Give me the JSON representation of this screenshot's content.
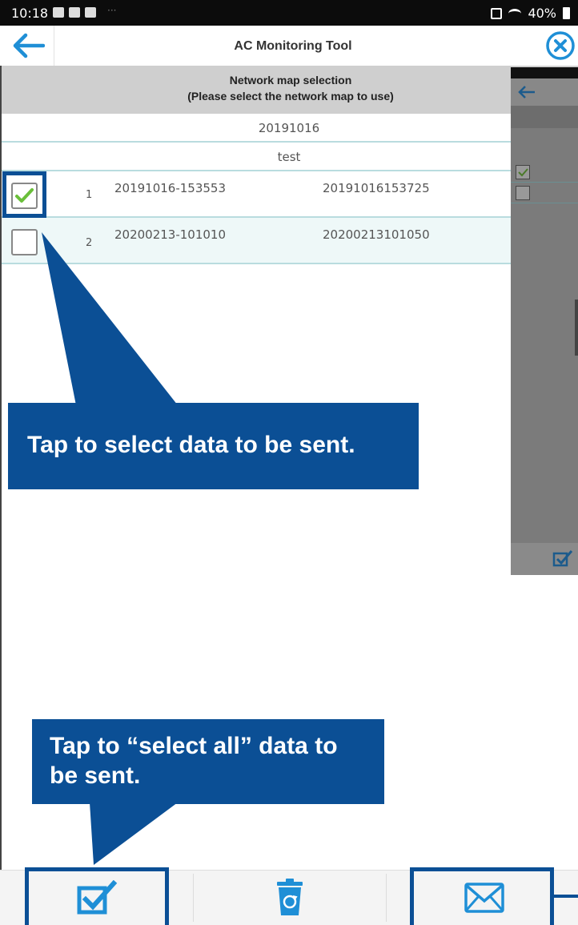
{
  "status_bar": {
    "time": "10:18",
    "dots": "···",
    "battery": "40%"
  },
  "header": {
    "title": "AC Monitoring Tool",
    "back_icon": "arrow-left-icon",
    "close_icon": "close-circle-icon"
  },
  "selection": {
    "title": "Network map selection",
    "subtitle": "(Please select the network map to use)"
  },
  "folders": [
    "20191016",
    "test"
  ],
  "rows": [
    {
      "index": "1",
      "name": "20191016-153553",
      "id": "20191016153725",
      "checked": true
    },
    {
      "index": "2",
      "name": "20200213-101010",
      "id": "20200213101050",
      "checked": false
    }
  ],
  "callouts": {
    "select": "Tap to select data to be sent.",
    "select_all": "Tap to “select all” data to be sent."
  },
  "toolbar": {
    "select_all_icon": "select-all-checkbox-icon",
    "delete_icon": "recycle-bin-icon",
    "send_icon": "mail-envelope-icon"
  },
  "colors": {
    "accent": "#0b4f95",
    "icon_blue": "#1f8fd6",
    "check_green": "#6abf3a",
    "row_border": "#b9dcdf",
    "row_alt": "#eef8f8"
  }
}
